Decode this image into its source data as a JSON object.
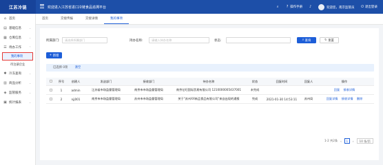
{
  "app": {
    "title": "江苏冷链",
    "platform": "欢迎进入江苏省进口冷链食品追溯平台"
  },
  "header": {
    "manual": "操作手册",
    "user": "欢迎您，南京监管员",
    "logout": "退出登录"
  },
  "sidebar": {
    "items": [
      {
        "label": "首页",
        "icon": "home-icon"
      },
      {
        "label": "基础信息",
        "icon": "info-icon"
      },
      {
        "label": "仓库信息",
        "icon": "warehouse-icon"
      },
      {
        "label": "待办工作",
        "icon": "todo-icon"
      }
    ],
    "sub_items": [
      {
        "label": "我的事项",
        "active": true
      },
      {
        "label": "待注册企业",
        "active": false
      }
    ],
    "items2": [
      {
        "label": "冷冻查询",
        "icon": "snow-icon"
      },
      {
        "label": "商品分析",
        "icon": "chart-icon"
      },
      {
        "label": "监管服务",
        "icon": "service-icon"
      },
      {
        "label": "统计报表",
        "icon": "report-icon"
      }
    ]
  },
  "tabs": [
    {
      "label": "首页"
    },
    {
      "label": "交接传报"
    },
    {
      "label": "交接详情"
    },
    {
      "label": "我的事项",
      "active": true
    }
  ],
  "filters": {
    "dept_label": "所属部门:",
    "dept_placeholder": "请选择所属部门",
    "company_label": "持办名称:",
    "company_placeholder": "请输入持办名称",
    "status_label": "状态:",
    "status_placeholder": "",
    "search": "查询",
    "reset": "重置"
  },
  "actions": {
    "add": "新增"
  },
  "selection": {
    "text": "已选择 0项",
    "clear": "清空"
  },
  "table": {
    "headers": [
      "序号",
      "创建人",
      "发送部门",
      "接收部门",
      "待办名称",
      "状态",
      "回复时间",
      "回复人",
      "操作"
    ],
    "rows": [
      {
        "no": "1",
        "creator": "admin",
        "from": "江苏省市场监督管理局",
        "to": "南京市市场监督管理局",
        "name": "南京亿旺国际贸易有限公司 1210000005437001",
        "status": "未完成",
        "time": "",
        "replier": "",
        "ops": [
          "回复",
          "接收详情"
        ]
      },
      {
        "no": "2",
        "creator": "njj001",
        "from": "南京市市场监督管理局",
        "to": "苏州市市场监督管理局",
        "name": "关于\"苏州XX新品食品有限公司\"来自出现的通报",
        "status": "完成",
        "time": "2021-01-30 14:53:11",
        "replier": "苏州局",
        "ops": [
          "回复详情",
          "接收详情",
          "删除"
        ]
      }
    ]
  },
  "pager": {
    "total": "1-2 共2条",
    "page": "1",
    "size": "10 条/页"
  }
}
